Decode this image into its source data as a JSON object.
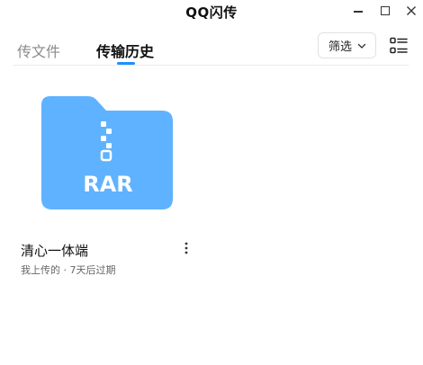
{
  "window": {
    "title": "QQ闪传"
  },
  "tabs": [
    {
      "label": "传文件",
      "active": false
    },
    {
      "label": "传输历史",
      "active": true
    }
  ],
  "toolbar": {
    "filter_label": "筛选",
    "filter_icon": "chevron-down-icon",
    "view_icon": "list-view-icon"
  },
  "files": [
    {
      "name": "清心一体端",
      "meta": "我上传的 · 7天后过期",
      "type_label": "RAR",
      "icon": "rar-archive-icon",
      "more_icon": "more-vertical-icon"
    }
  ],
  "colors": {
    "accent": "#1f8fff",
    "folder": "#5fb2ff",
    "folder_tab": "#4ea8ff"
  }
}
